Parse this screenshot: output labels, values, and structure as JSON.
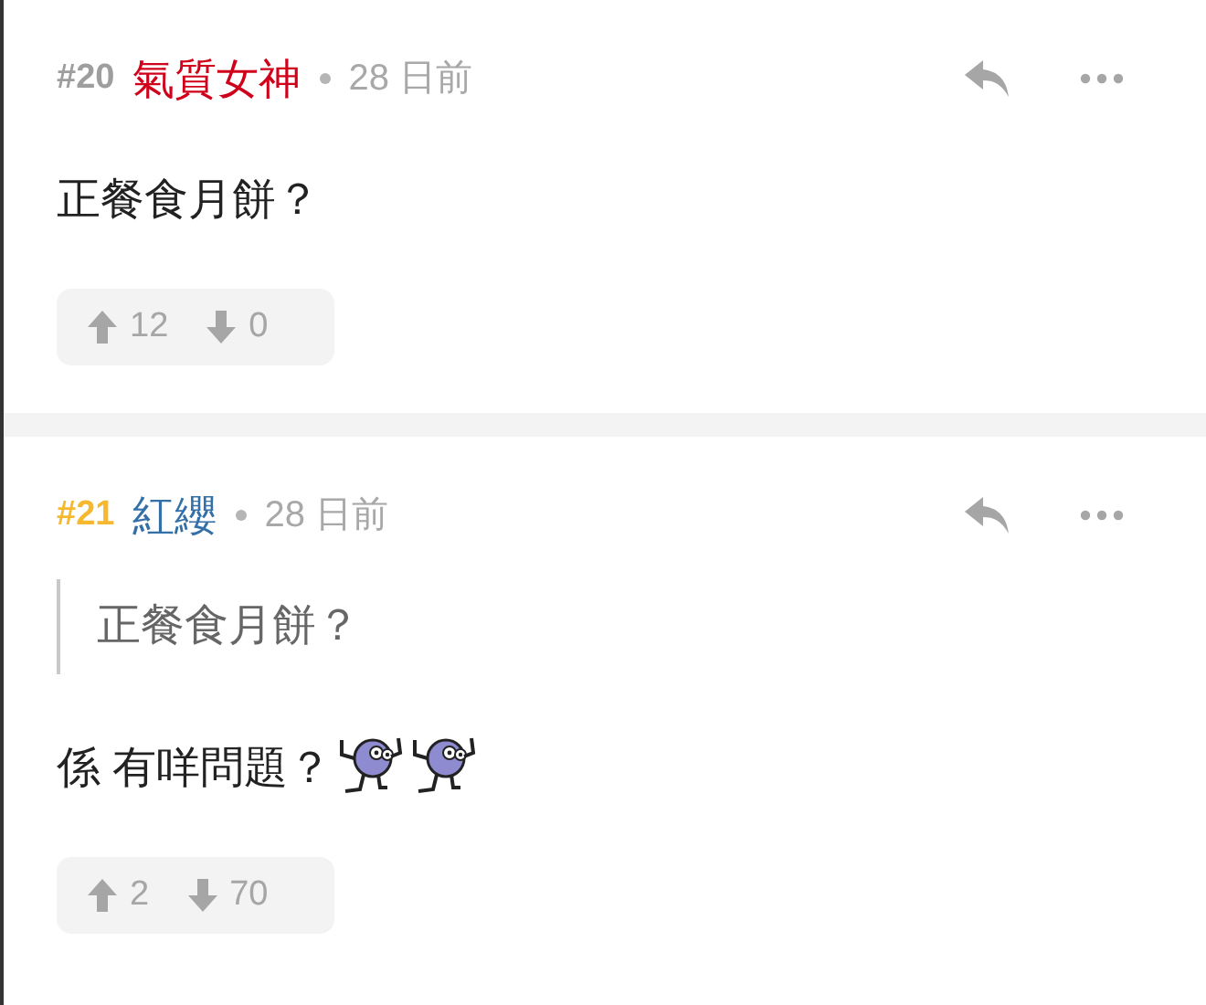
{
  "posts": [
    {
      "number": {
        "text": "#20",
        "color": "#9e9e9e"
      },
      "author": {
        "name": "氣質女神",
        "color": "#d0021b"
      },
      "time": "28 日前",
      "blocks": [
        {
          "kind": "text",
          "text": "正餐食月餅？"
        }
      ],
      "upvotes": "12",
      "downvotes": "0"
    },
    {
      "number": {
        "text": "#21",
        "color": "#f5b82e"
      },
      "author": {
        "name": "紅纓",
        "color": "#3470a8"
      },
      "time": "28 日前",
      "blocks": [
        {
          "kind": "quote",
          "text": "正餐食月餅？"
        },
        {
          "kind": "text",
          "text": "係 有咩問題？",
          "stickers": [
            {
              "kind": "sticker"
            },
            {
              "kind": "sticker"
            }
          ]
        }
      ],
      "upvotes": "2",
      "downvotes": "70"
    }
  ]
}
